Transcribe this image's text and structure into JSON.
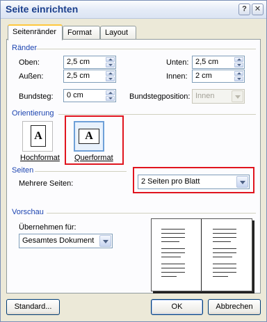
{
  "window": {
    "title": "Seite einrichten",
    "help_glyph": "?",
    "close_glyph": "✕"
  },
  "tabs": [
    {
      "label": "Seitenränder",
      "active": true
    },
    {
      "label": "Format",
      "active": false
    },
    {
      "label": "Layout",
      "active": false
    }
  ],
  "margins": {
    "section": "Ränder",
    "oben": {
      "label": "Oben:",
      "value": "2,5 cm"
    },
    "aussen": {
      "label": "Außen:",
      "value": "2,5 cm"
    },
    "unten": {
      "label": "Unten:",
      "value": "2,5 cm"
    },
    "innen": {
      "label": "Innen:",
      "value": "2 cm"
    },
    "bundsteg": {
      "label": "Bundsteg:",
      "value": "0 cm"
    },
    "bundstegposition": {
      "label": "Bundstegposition:",
      "value": "Innen",
      "disabled": true
    }
  },
  "orientation": {
    "section": "Orientierung",
    "hochformat": {
      "label": "Hochformat",
      "glyph": "A"
    },
    "querformat": {
      "label": "Querformat",
      "glyph": "A",
      "selected": true
    }
  },
  "pages": {
    "section": "Seiten",
    "mehrere_label": "Mehrere Seiten:",
    "mehrere_value": "2 Seiten pro Blatt"
  },
  "preview": {
    "section": "Vorschau",
    "apply_label": "Übernehmen für:",
    "apply_value": "Gesamtes Dokument"
  },
  "buttons": {
    "standard": "Standard...",
    "ok": "OK",
    "cancel": "Abbrechen"
  },
  "colors": {
    "section_label": "#1c44b0",
    "highlight": "#e0141e",
    "tab_accent": "#ffc83c"
  }
}
